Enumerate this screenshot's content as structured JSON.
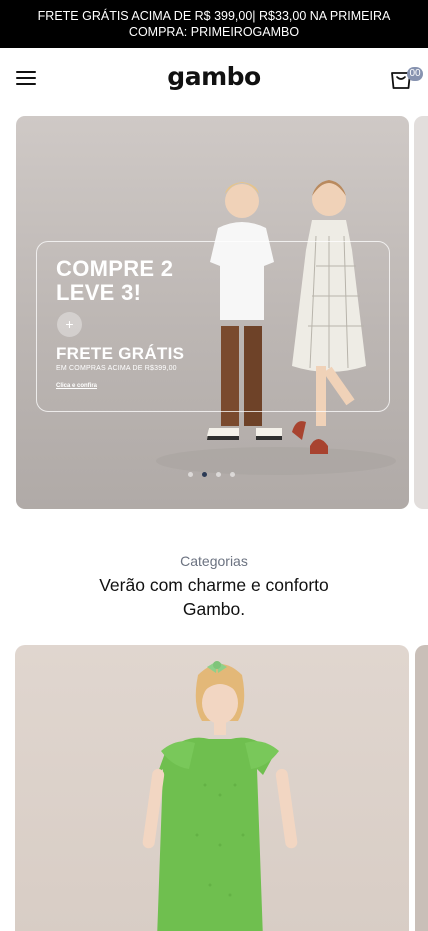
{
  "announcement": {
    "text": "FRETE GRÁTIS ACIMA DE R$ 399,00| R$33,00 NA PRIMEIRA COMPRA: PRIMEIROGAMBO"
  },
  "header": {
    "logo": "gambo",
    "menu_icon": "hamburger-menu-icon",
    "cart_icon": "shopping-bag-icon",
    "cart_count": "00"
  },
  "hero": {
    "title": "COMPRE 2 LEVE 3!",
    "plus": "+",
    "subtitle": "FRETE GRÁTIS",
    "small_text": "EM COMPRAS ACIMA DE R$399,00",
    "link_text": "Clica e confira",
    "slide_count": 4,
    "active_slide": 2
  },
  "categories": {
    "label": "Categorias",
    "title": "Verão com charme e conforto Gambo."
  },
  "colors": {
    "announcement_bg": "#000000",
    "badge": "#8793b0",
    "active_dot": "#2b3a55",
    "dress_green": "#6fbf4f"
  }
}
